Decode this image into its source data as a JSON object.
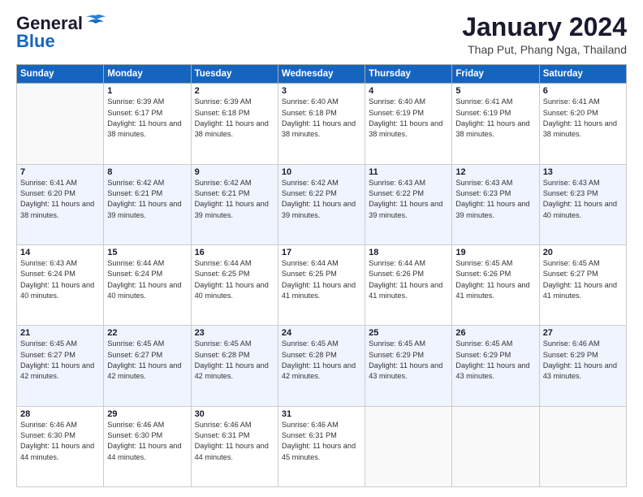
{
  "header": {
    "logo_general": "General",
    "logo_blue": "Blue",
    "month_title": "January 2024",
    "location": "Thap Put, Phang Nga, Thailand"
  },
  "days_of_week": [
    "Sunday",
    "Monday",
    "Tuesday",
    "Wednesday",
    "Thursday",
    "Friday",
    "Saturday"
  ],
  "weeks": [
    [
      {
        "day": "",
        "sunrise": "",
        "sunset": "",
        "daylight": ""
      },
      {
        "day": "1",
        "sunrise": "Sunrise: 6:39 AM",
        "sunset": "Sunset: 6:17 PM",
        "daylight": "Daylight: 11 hours and 38 minutes."
      },
      {
        "day": "2",
        "sunrise": "Sunrise: 6:39 AM",
        "sunset": "Sunset: 6:18 PM",
        "daylight": "Daylight: 11 hours and 38 minutes."
      },
      {
        "day": "3",
        "sunrise": "Sunrise: 6:40 AM",
        "sunset": "Sunset: 6:18 PM",
        "daylight": "Daylight: 11 hours and 38 minutes."
      },
      {
        "day": "4",
        "sunrise": "Sunrise: 6:40 AM",
        "sunset": "Sunset: 6:19 PM",
        "daylight": "Daylight: 11 hours and 38 minutes."
      },
      {
        "day": "5",
        "sunrise": "Sunrise: 6:41 AM",
        "sunset": "Sunset: 6:19 PM",
        "daylight": "Daylight: 11 hours and 38 minutes."
      },
      {
        "day": "6",
        "sunrise": "Sunrise: 6:41 AM",
        "sunset": "Sunset: 6:20 PM",
        "daylight": "Daylight: 11 hours and 38 minutes."
      }
    ],
    [
      {
        "day": "7",
        "sunrise": "Sunrise: 6:41 AM",
        "sunset": "Sunset: 6:20 PM",
        "daylight": "Daylight: 11 hours and 38 minutes."
      },
      {
        "day": "8",
        "sunrise": "Sunrise: 6:42 AM",
        "sunset": "Sunset: 6:21 PM",
        "daylight": "Daylight: 11 hours and 39 minutes."
      },
      {
        "day": "9",
        "sunrise": "Sunrise: 6:42 AM",
        "sunset": "Sunset: 6:21 PM",
        "daylight": "Daylight: 11 hours and 39 minutes."
      },
      {
        "day": "10",
        "sunrise": "Sunrise: 6:42 AM",
        "sunset": "Sunset: 6:22 PM",
        "daylight": "Daylight: 11 hours and 39 minutes."
      },
      {
        "day": "11",
        "sunrise": "Sunrise: 6:43 AM",
        "sunset": "Sunset: 6:22 PM",
        "daylight": "Daylight: 11 hours and 39 minutes."
      },
      {
        "day": "12",
        "sunrise": "Sunrise: 6:43 AM",
        "sunset": "Sunset: 6:23 PM",
        "daylight": "Daylight: 11 hours and 39 minutes."
      },
      {
        "day": "13",
        "sunrise": "Sunrise: 6:43 AM",
        "sunset": "Sunset: 6:23 PM",
        "daylight": "Daylight: 11 hours and 40 minutes."
      }
    ],
    [
      {
        "day": "14",
        "sunrise": "Sunrise: 6:43 AM",
        "sunset": "Sunset: 6:24 PM",
        "daylight": "Daylight: 11 hours and 40 minutes."
      },
      {
        "day": "15",
        "sunrise": "Sunrise: 6:44 AM",
        "sunset": "Sunset: 6:24 PM",
        "daylight": "Daylight: 11 hours and 40 minutes."
      },
      {
        "day": "16",
        "sunrise": "Sunrise: 6:44 AM",
        "sunset": "Sunset: 6:25 PM",
        "daylight": "Daylight: 11 hours and 40 minutes."
      },
      {
        "day": "17",
        "sunrise": "Sunrise: 6:44 AM",
        "sunset": "Sunset: 6:25 PM",
        "daylight": "Daylight: 11 hours and 41 minutes."
      },
      {
        "day": "18",
        "sunrise": "Sunrise: 6:44 AM",
        "sunset": "Sunset: 6:26 PM",
        "daylight": "Daylight: 11 hours and 41 minutes."
      },
      {
        "day": "19",
        "sunrise": "Sunrise: 6:45 AM",
        "sunset": "Sunset: 6:26 PM",
        "daylight": "Daylight: 11 hours and 41 minutes."
      },
      {
        "day": "20",
        "sunrise": "Sunrise: 6:45 AM",
        "sunset": "Sunset: 6:27 PM",
        "daylight": "Daylight: 11 hours and 41 minutes."
      }
    ],
    [
      {
        "day": "21",
        "sunrise": "Sunrise: 6:45 AM",
        "sunset": "Sunset: 6:27 PM",
        "daylight": "Daylight: 11 hours and 42 minutes."
      },
      {
        "day": "22",
        "sunrise": "Sunrise: 6:45 AM",
        "sunset": "Sunset: 6:27 PM",
        "daylight": "Daylight: 11 hours and 42 minutes."
      },
      {
        "day": "23",
        "sunrise": "Sunrise: 6:45 AM",
        "sunset": "Sunset: 6:28 PM",
        "daylight": "Daylight: 11 hours and 42 minutes."
      },
      {
        "day": "24",
        "sunrise": "Sunrise: 6:45 AM",
        "sunset": "Sunset: 6:28 PM",
        "daylight": "Daylight: 11 hours and 42 minutes."
      },
      {
        "day": "25",
        "sunrise": "Sunrise: 6:45 AM",
        "sunset": "Sunset: 6:29 PM",
        "daylight": "Daylight: 11 hours and 43 minutes."
      },
      {
        "day": "26",
        "sunrise": "Sunrise: 6:45 AM",
        "sunset": "Sunset: 6:29 PM",
        "daylight": "Daylight: 11 hours and 43 minutes."
      },
      {
        "day": "27",
        "sunrise": "Sunrise: 6:46 AM",
        "sunset": "Sunset: 6:29 PM",
        "daylight": "Daylight: 11 hours and 43 minutes."
      }
    ],
    [
      {
        "day": "28",
        "sunrise": "Sunrise: 6:46 AM",
        "sunset": "Sunset: 6:30 PM",
        "daylight": "Daylight: 11 hours and 44 minutes."
      },
      {
        "day": "29",
        "sunrise": "Sunrise: 6:46 AM",
        "sunset": "Sunset: 6:30 PM",
        "daylight": "Daylight: 11 hours and 44 minutes."
      },
      {
        "day": "30",
        "sunrise": "Sunrise: 6:46 AM",
        "sunset": "Sunset: 6:31 PM",
        "daylight": "Daylight: 11 hours and 44 minutes."
      },
      {
        "day": "31",
        "sunrise": "Sunrise: 6:46 AM",
        "sunset": "Sunset: 6:31 PM",
        "daylight": "Daylight: 11 hours and 45 minutes."
      },
      {
        "day": "",
        "sunrise": "",
        "sunset": "",
        "daylight": ""
      },
      {
        "day": "",
        "sunrise": "",
        "sunset": "",
        "daylight": ""
      },
      {
        "day": "",
        "sunrise": "",
        "sunset": "",
        "daylight": ""
      }
    ]
  ]
}
